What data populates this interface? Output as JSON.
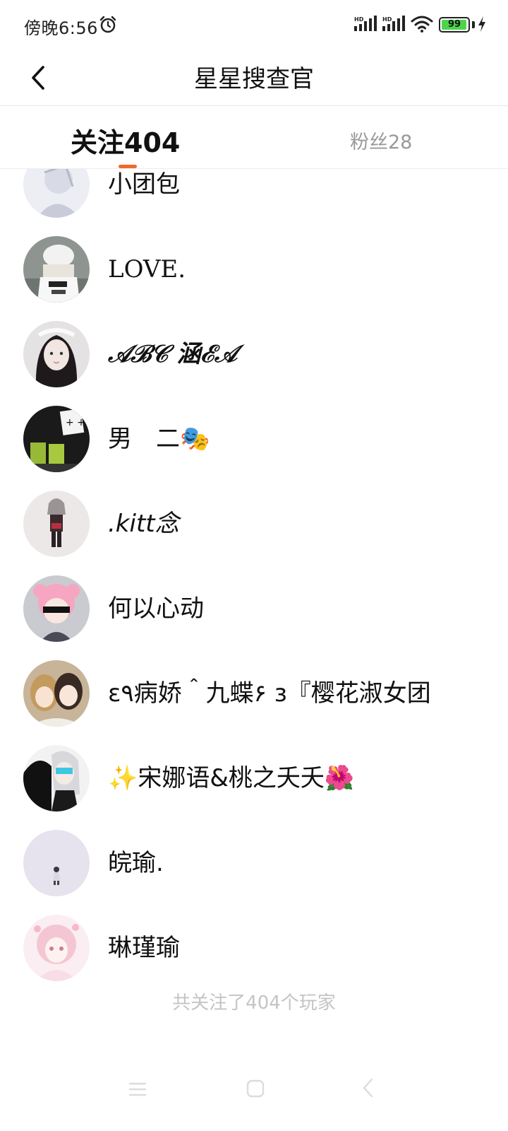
{
  "status_bar": {
    "time": "傍晚6:56",
    "network_1": "HD",
    "network_2": "HD",
    "battery": "99"
  },
  "header": {
    "title": "星星搜查官"
  },
  "tabs": {
    "following": "关注404",
    "fans": "粉丝28"
  },
  "users": [
    {
      "name": "小团包"
    },
    {
      "name": "LOVE."
    },
    {
      "name": "𝒜ℬ𝒞 涵ℰ𝒜"
    },
    {
      "name": "男　二🎭"
    },
    {
      "name": ".kitt念"
    },
    {
      "name": "何以心动"
    },
    {
      "name": "ε٩病娇＾九蝶۶ з『樱花淑女团"
    },
    {
      "name": "✨宋娜语&桃之夭夭🌺"
    },
    {
      "name": "皖瑜."
    },
    {
      "name": "琳瑾瑜"
    }
  ],
  "footer": {
    "count_text": "共关注了404个玩家"
  }
}
